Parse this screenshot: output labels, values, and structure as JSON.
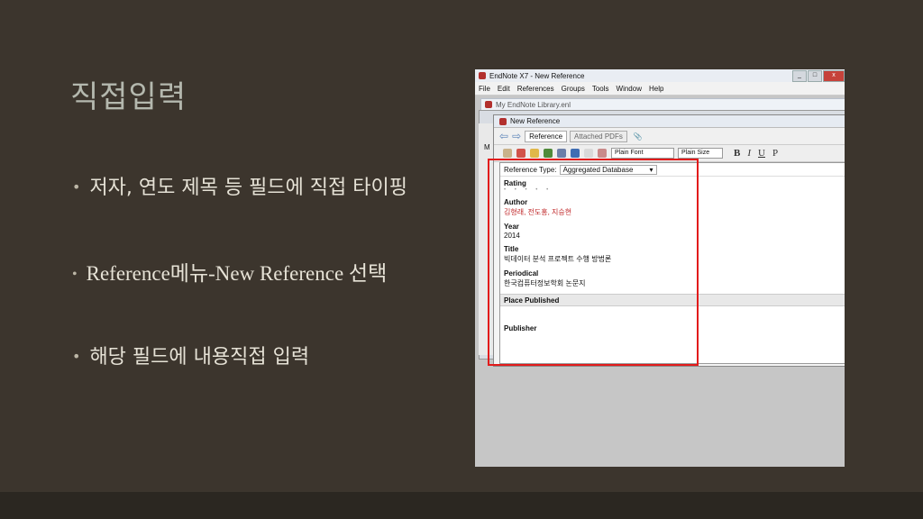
{
  "slide": {
    "title": "직접입력",
    "bullets": [
      "저자, 연도 제목 등 필드에 직접 타이핑",
      "Reference메뉴-New Reference 선택",
      "해당 필드에 내용직접 입력"
    ],
    "bullet_symbol": "•"
  },
  "endnote": {
    "window_title": "EndNote X7 - New Reference",
    "window_buttons": [
      "_",
      "□",
      "x"
    ],
    "menu": [
      "File",
      "Edit",
      "References",
      "Groups",
      "Tools",
      "Window",
      "Help"
    ],
    "library_title": "My EndNote Library.enl",
    "ref_window_title": "New Reference",
    "left_pane_letter": "M",
    "tabs": [
      "Reference",
      "Attached PDFs"
    ],
    "font_select": "Plain Font",
    "size_select": "Plain Size",
    "format_buttons": [
      "B",
      "I",
      "U",
      "P"
    ],
    "reference_type_label": "Reference Type:",
    "reference_type_value": "Aggregated Database",
    "fields": {
      "rating_label": "Rating",
      "author_label": "Author",
      "author_value": "김형래, 전도홍, 지승현",
      "year_label": "Year",
      "year_value": "2014",
      "title_label": "Title",
      "title_value": "빅데이터 분석 프로젝트 수행 방법론",
      "periodical_label": "Periodical",
      "periodical_value": "한국컴퓨터정보학회 논문지",
      "place_label": "Place Published",
      "publisher_label": "Publisher"
    },
    "highlight_color": "#e21b1b"
  }
}
